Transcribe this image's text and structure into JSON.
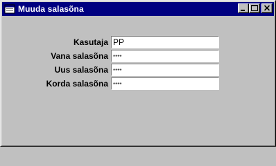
{
  "window": {
    "title": "Muuda salasõna"
  },
  "form": {
    "fields": [
      {
        "label": "Kasutaja",
        "value": "PP"
      },
      {
        "label": "Vana salasõna",
        "value": "****"
      },
      {
        "label": "Uus salasõna",
        "value": "****"
      },
      {
        "label": "Korda salasõna",
        "value": "****"
      }
    ]
  },
  "colors": {
    "titlebar": "#000080",
    "window_bg": "#c0c0c0",
    "input_bg": "#ffffff"
  }
}
